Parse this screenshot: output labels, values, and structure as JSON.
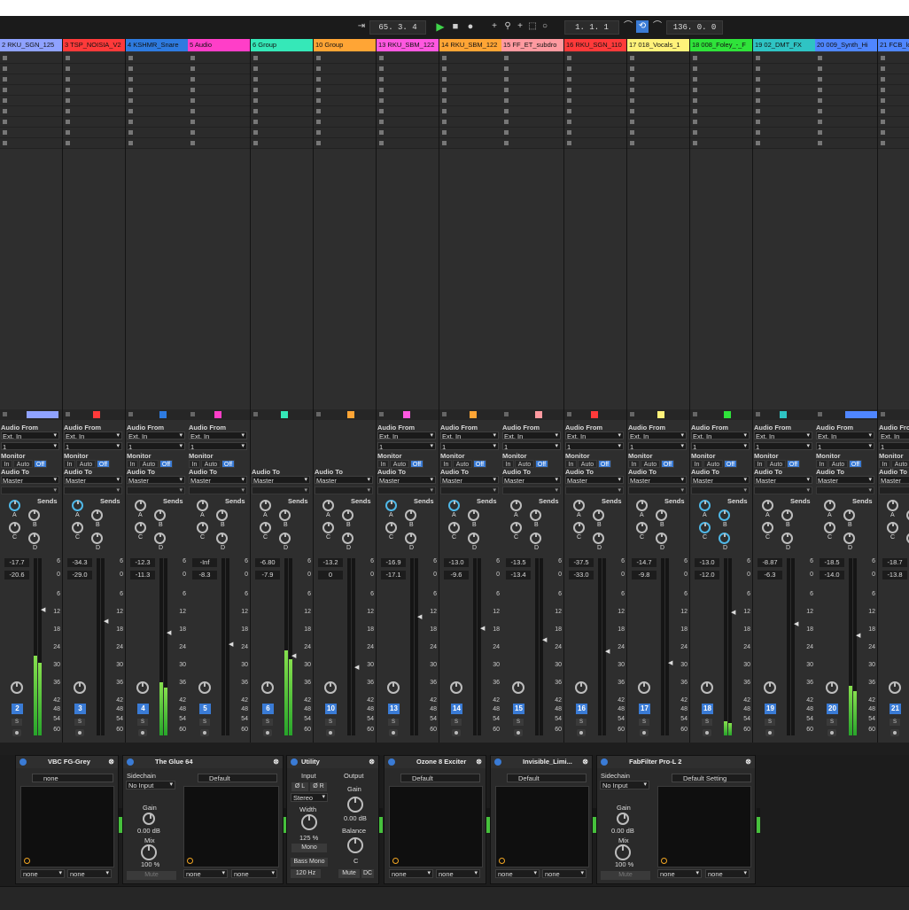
{
  "transport": {
    "position": "65. 3. 4",
    "loop_start": "1. 1. 1",
    "loop_length": "136. 0. 0"
  },
  "tracks": [
    {
      "name": "2 RKU_SGN_125",
      "color": "#8fa2ff",
      "audio_from": "Ext. In",
      "channel": "1",
      "audio_to": "Master",
      "vol": "-17.7",
      "peak": "-20.6",
      "number": "2",
      "meter": 0.45
    },
    {
      "name": "3 TSP_NOISIA_V2",
      "color": "#ff3a3a",
      "audio_from": "Ext. In",
      "channel": "1",
      "audio_to": "Master",
      "vol": "-34.3",
      "peak": "-29.0",
      "number": "3",
      "meter": 0
    },
    {
      "name": "4 KSHMR_Snare",
      "color": "#2e7be0",
      "audio_from": "Ext. In",
      "channel": "1",
      "audio_to": "Master",
      "vol": "-12.3",
      "peak": "-11.3",
      "number": "4",
      "meter": 0.3
    },
    {
      "name": "5 Audio",
      "color": "#ff3ec8",
      "audio_from": "Ext. In",
      "channel": "1",
      "audio_to": "Master",
      "vol": "-Inf",
      "peak": "-8.3",
      "number": "5",
      "meter": 0
    },
    {
      "name": "6 Group",
      "color": "#35e8b8",
      "audio_from": "",
      "channel": "",
      "audio_to": "Master",
      "vol": "-6.80",
      "peak": "-7.9",
      "number": "6",
      "meter": 0.48
    },
    {
      "name": "10 Group",
      "color": "#ffa535",
      "audio_from": "",
      "channel": "",
      "audio_to": "Master",
      "vol": "-13.2",
      "peak": "0",
      "number": "10",
      "meter": 0
    },
    {
      "name": "13 RKU_SBM_122",
      "color": "#ff58e0",
      "audio_from": "Ext. In",
      "channel": "1",
      "audio_to": "Master",
      "vol": "-16.9",
      "peak": "-17.1",
      "number": "13",
      "meter": 0
    },
    {
      "name": "14 RKU_SBM_122",
      "color": "#ffa535",
      "audio_from": "Ext. In",
      "channel": "1",
      "audio_to": "Master",
      "vol": "-13.0",
      "peak": "-9.6",
      "number": "14",
      "meter": 0
    },
    {
      "name": "15 FF_ET_subdro",
      "color": "#ff9aa0",
      "audio_from": "Ext. In",
      "channel": "1",
      "audio_to": "Master",
      "vol": "-13.5",
      "peak": "-13.4",
      "number": "15",
      "meter": 0
    },
    {
      "name": "16 RKU_SGN_110",
      "color": "#ff3a3a",
      "audio_from": "Ext. In",
      "channel": "1",
      "audio_to": "Master",
      "vol": "-37.5",
      "peak": "-33.0",
      "number": "16",
      "meter": 0
    },
    {
      "name": "17 018_Vocals_1",
      "color": "#fff27a",
      "audio_from": "Ext. In",
      "channel": "1",
      "audio_to": "Master",
      "vol": "-14.7",
      "peak": "-9.8",
      "number": "17",
      "meter": 0
    },
    {
      "name": "18 008_Foley_-_F",
      "color": "#2fe33a",
      "audio_from": "Ext. In",
      "channel": "1",
      "audio_to": "Master",
      "vol": "-13.0",
      "peak": "-12.0",
      "number": "18",
      "meter": 0.08
    },
    {
      "name": "19 02_DMT_FX",
      "color": "#2fc4c4",
      "audio_from": "Ext. In",
      "channel": "1",
      "audio_to": "Master",
      "vol": "-8.87",
      "peak": "-6.3",
      "number": "19",
      "meter": 0
    },
    {
      "name": "20 009_Synth_Hi",
      "color": "#4f86ff",
      "audio_from": "Ext. In",
      "channel": "1",
      "audio_to": "Master",
      "vol": "-18.5",
      "peak": "-14.0",
      "number": "20",
      "meter": 0.28
    },
    {
      "name": "21 FCB_lo",
      "color": "#4f86ff",
      "audio_from": "Ext. In",
      "channel": "1",
      "audio_to": "Master",
      "vol": "-18.7",
      "peak": "-13.8",
      "number": "21",
      "meter": 0
    }
  ],
  "labels": {
    "audio_from": "Audio From",
    "monitor": "Monitor",
    "audio_to": "Audio To",
    "sends": "Sends",
    "mon_in": "In",
    "mon_auto": "Auto",
    "mon_off": "Off",
    "solo": "S",
    "send_a": "A",
    "send_b": "B",
    "send_c": "C",
    "send_d": "D"
  },
  "scale": [
    "6",
    "0",
    "6",
    "12",
    "18",
    "24",
    "30",
    "36",
    "42",
    "48",
    "54",
    "60"
  ],
  "devices": {
    "vbc": {
      "title": "VBC FG-Grey",
      "preset": "none",
      "out1": "none",
      "out2": "none"
    },
    "glue": {
      "title": "The Glue 64",
      "sidechain": "Sidechain",
      "sc_input": "No Input",
      "gain_label": "Gain",
      "gain": "0.00 dB",
      "mix_label": "Mix",
      "mix": "100 %",
      "mute": "Mute",
      "preset": "Default",
      "out1": "none",
      "out2": "none"
    },
    "utility": {
      "title": "Utility",
      "input": "Input",
      "output": "Output",
      "phase_l": "Ø L",
      "phase_r": "Ø R",
      "mode": "Stereo",
      "width_label": "Width",
      "width": "125 %",
      "mono": "Mono",
      "bass_mono": "Bass Mono",
      "bass_freq": "120 Hz",
      "gain_label": "Gain",
      "gain": "0.00 dB",
      "balance_label": "Balance",
      "balance": "C",
      "mute": "Mute",
      "dc": "DC"
    },
    "ozone": {
      "title": "Ozone 8 Exciter",
      "preset": "Default",
      "out1": "none",
      "out2": "none"
    },
    "invisible": {
      "title": "Invisible_Limi...",
      "preset": "Default",
      "out1": "none",
      "out2": "none"
    },
    "fabfilter": {
      "title": "FabFilter Pro-L 2",
      "sidechain": "Sidechain",
      "sc_input": "No Input",
      "gain_label": "Gain",
      "gain": "0.00 dB",
      "mix_label": "Mix",
      "mix": "100 %",
      "mute": "Mute",
      "preset": "Default Setting",
      "out1": "none",
      "out2": "none"
    }
  }
}
